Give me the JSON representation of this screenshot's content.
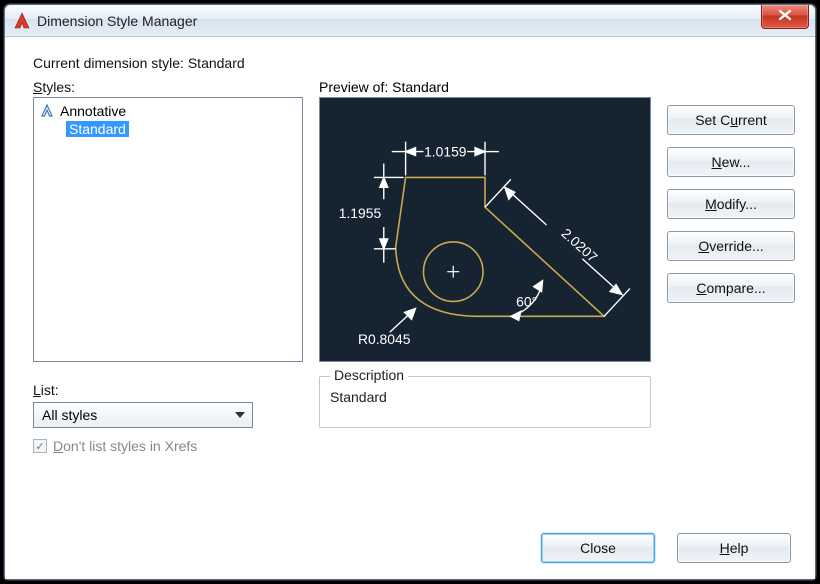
{
  "window": {
    "title": "Dimension Style Manager"
  },
  "current_line": "Current dimension style: Standard",
  "styles_label": "Styles:",
  "styles": {
    "items": [
      "Annotative",
      "Standard"
    ],
    "selected": "Standard"
  },
  "list_section": {
    "label": "List:",
    "value": "All styles",
    "checkbox_label": "Don't list styles in Xrefs",
    "checkbox_checked": true,
    "checkbox_disabled": true
  },
  "preview": {
    "label": "Preview of: Standard",
    "dims": {
      "top": "1.0159",
      "left": "1.1955",
      "diag": "2.0207",
      "angle": "60°",
      "radius": "R0.8045"
    }
  },
  "description": {
    "label": "Description",
    "value": "Standard"
  },
  "buttons": {
    "set_current": "Set Current",
    "new": "New...",
    "modify": "Modify...",
    "override": "Override...",
    "compare": "Compare...",
    "close": "Close",
    "help": "Help"
  }
}
